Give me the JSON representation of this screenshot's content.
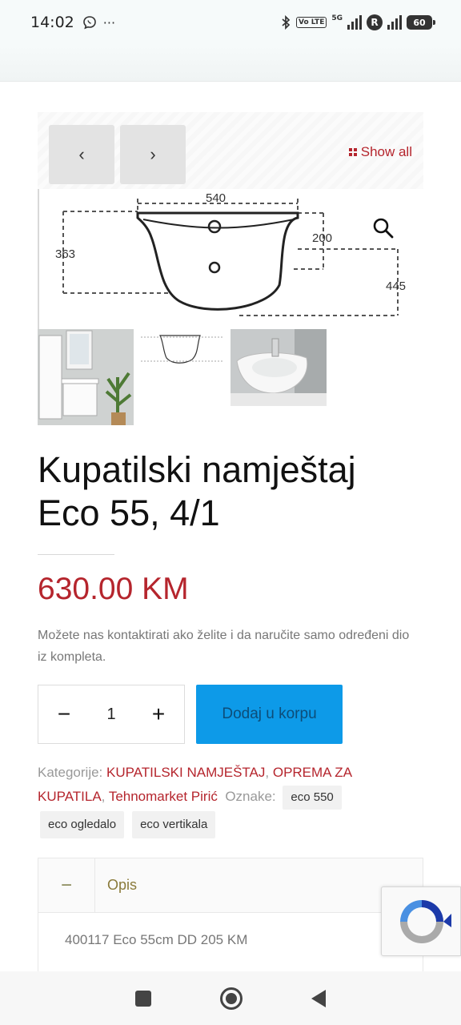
{
  "status_bar": {
    "time": "14:02",
    "more": "···",
    "network": "5G",
    "volte": "Vo LTE",
    "roaming_badge": "R",
    "battery": "60"
  },
  "gallery": {
    "prev_label": "‹",
    "next_label": "›",
    "show_all": "Show all",
    "dimensions": {
      "width": "540",
      "height_left": "363",
      "depth": "200",
      "height_right": "445"
    }
  },
  "product": {
    "title_line1": "Kupatilski namještaj",
    "title_line2": "Eco 55, 4/1",
    "price": "630.00 KM",
    "note": "Možete nas kontaktirati ako želite i da naručite samo određeni dio iz kompleta.",
    "quantity": "1",
    "qty_minus": "−",
    "qty_plus": "+",
    "add_to_cart": "Dodaj u korpu"
  },
  "meta": {
    "categories_label": "Kategorije:",
    "categories": [
      "KUPATILSKI NAMJEŠTAJ",
      "OPREMA ZA KUPATILA",
      "Tehnomarket Pirić"
    ],
    "tags_label": "Oznake:",
    "tags": [
      "eco 550",
      "eco ogledalo",
      "eco vertikala"
    ]
  },
  "accordion": {
    "toggle": "−",
    "title": "Opis",
    "body": "400117 Eco 55cm DD 205 KM"
  },
  "colors": {
    "accent_red": "#b5252d",
    "button_blue": "#0d9ae8"
  }
}
